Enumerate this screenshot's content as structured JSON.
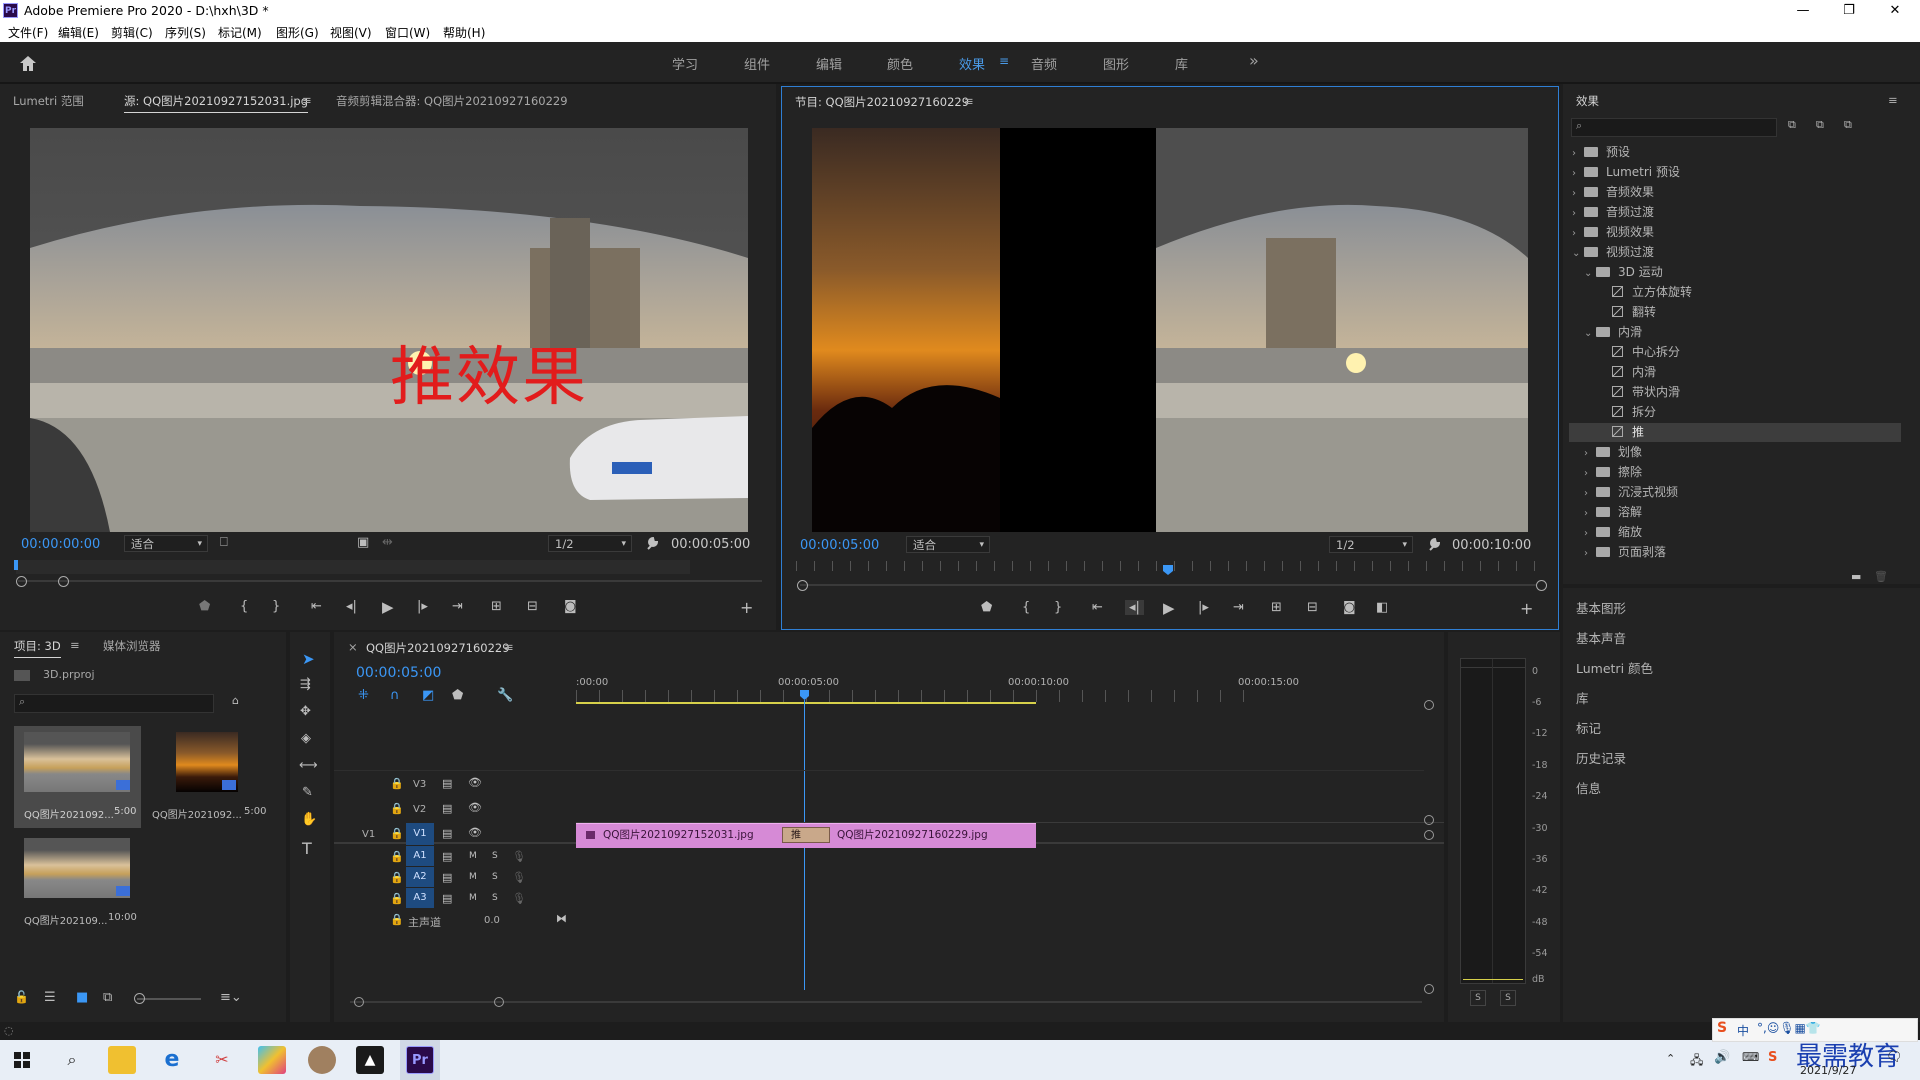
{
  "app": {
    "title": "Adobe Premiere Pro 2020 - D:\\hxh\\3D *",
    "logo": "Pr",
    "window_controls": {
      "minimize": "—",
      "maximize": "❐",
      "close": "✕"
    }
  },
  "menu": [
    "文件(F)",
    "编辑(E)",
    "剪辑(C)",
    "序列(S)",
    "标记(M)",
    "图形(G)",
    "视图(V)",
    "窗口(W)",
    "帮助(H)"
  ],
  "workspaces": {
    "items": [
      "学习",
      "组件",
      "编辑",
      "颜色",
      "效果",
      "音频",
      "图形",
      "库"
    ],
    "active": "效果",
    "overflow": "»"
  },
  "source_monitor": {
    "tabs": [
      "Lumetri 范围",
      "源: QQ图片20210927152031.jpg",
      "音频剪辑混合器: QQ图片20210927160229"
    ],
    "overlay_text": "推效果",
    "timecode_in": "00:00:00:00",
    "fit": "适合",
    "resolution": "1/2",
    "timecode_duration": "00:00:05:00"
  },
  "program_monitor": {
    "tab": "节目: QQ图片20210927160229",
    "timecode_in": "00:00:05:00",
    "fit": "适合",
    "resolution": "1/2",
    "timecode_duration": "00:00:10:00"
  },
  "effects_panel": {
    "title": "效果",
    "search_placeholder": "",
    "tree": [
      {
        "label": "预设",
        "type": "folder",
        "level": 0,
        "expanded": false
      },
      {
        "label": "Lumetri 预设",
        "type": "folder",
        "level": 0,
        "expanded": false
      },
      {
        "label": "音频效果",
        "type": "folder",
        "level": 0,
        "expanded": false
      },
      {
        "label": "音频过渡",
        "type": "folder",
        "level": 0,
        "expanded": false
      },
      {
        "label": "视频效果",
        "type": "folder",
        "level": 0,
        "expanded": false
      },
      {
        "label": "视频过渡",
        "type": "folder",
        "level": 0,
        "expanded": true
      },
      {
        "label": "3D 运动",
        "type": "folder",
        "level": 1,
        "expanded": true
      },
      {
        "label": "立方体旋转",
        "type": "effect",
        "level": 2
      },
      {
        "label": "翻转",
        "type": "effect",
        "level": 2
      },
      {
        "label": "内滑",
        "type": "folder",
        "level": 1,
        "expanded": true
      },
      {
        "label": "中心拆分",
        "type": "effect",
        "level": 2
      },
      {
        "label": "内滑",
        "type": "effect",
        "level": 2
      },
      {
        "label": "带状内滑",
        "type": "effect",
        "level": 2
      },
      {
        "label": "拆分",
        "type": "effect",
        "level": 2
      },
      {
        "label": "推",
        "type": "effect",
        "level": 2,
        "selected": true
      },
      {
        "label": "划像",
        "type": "folder",
        "level": 1,
        "expanded": false
      },
      {
        "label": "擦除",
        "type": "folder",
        "level": 1,
        "expanded": false
      },
      {
        "label": "沉浸式视频",
        "type": "folder",
        "level": 1,
        "expanded": false
      },
      {
        "label": "溶解",
        "type": "folder",
        "level": 1,
        "expanded": false
      },
      {
        "label": "缩放",
        "type": "folder",
        "level": 1,
        "expanded": false
      },
      {
        "label": "页面剥落",
        "type": "folder",
        "level": 1,
        "expanded": false
      }
    ],
    "side_panels": [
      "基本图形",
      "基本声音",
      "Lumetri 颜色",
      "库",
      "标记",
      "历史记录",
      "信息"
    ]
  },
  "project_panel": {
    "tabs": [
      "项目: 3D",
      "媒体浏览器"
    ],
    "project_file": "3D.prproj",
    "items": [
      {
        "name": "QQ图片2021092...",
        "duration": "5:00"
      },
      {
        "name": "QQ图片2021092...",
        "duration": "5:00"
      },
      {
        "name": "QQ图片202109...",
        "duration": "10:00"
      }
    ]
  },
  "timeline": {
    "tab": "QQ图片20210927160229",
    "timecode": "00:00:05:00",
    "ruler": [
      ":00:00",
      "00:00:05:00",
      "00:00:10:00",
      "00:00:15:00"
    ],
    "tracks_video": [
      "V3",
      "V2",
      "V1"
    ],
    "tracks_audio": [
      "A1",
      "A2",
      "A3"
    ],
    "source_patch": "V1",
    "master_label": "主声道",
    "master_value": "0.0",
    "clips": [
      {
        "name": "QQ图片20210927152031.jpg"
      },
      {
        "name": "QQ图片20210927160229.jpg"
      }
    ],
    "transition_label": "推",
    "track_letters": {
      "mute": "M",
      "solo": "S"
    }
  },
  "audio_meter": {
    "scale": [
      "0",
      "-6",
      "-12",
      "-18",
      "-24",
      "-30",
      "-36",
      "-42",
      "-48",
      "-54",
      "dB"
    ],
    "solo_buttons": [
      "S",
      "S"
    ]
  },
  "taskbar": {
    "clock_date": "2021/9/27",
    "ime": "中",
    "watermark": "最需教育"
  },
  "colors": {
    "accent_blue": "#3b97f5",
    "clip_pink": "#d68ad6",
    "panel_bg": "#232323",
    "selection_border": "#2f7fd4"
  }
}
